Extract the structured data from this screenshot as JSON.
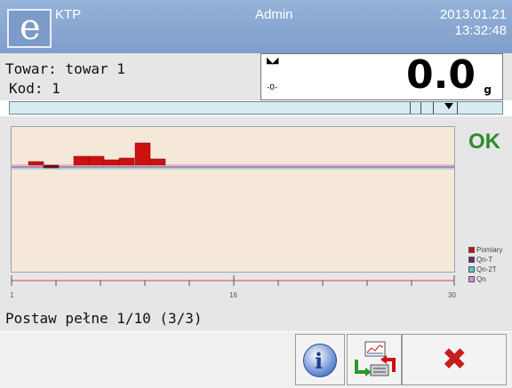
{
  "header": {
    "logo_letter": "e",
    "app_name": "KTP",
    "user": "Admin",
    "date": "2013.01.21",
    "time": "13:32:48"
  },
  "product": {
    "line1": "Towar: towar 1",
    "line2": "Kod: 1"
  },
  "display": {
    "zero_indicator": "-0-",
    "value": "0.0",
    "unit": "g"
  },
  "status": {
    "result": "OK",
    "message": "Postaw pełne 1/10 (3/3)"
  },
  "legend": [
    {
      "label": "Pomiary",
      "color": "#cc1111"
    },
    {
      "label": "Qn-T",
      "color": "#7a1f7a"
    },
    {
      "label": "Qn-2T",
      "color": "#5ac8c8"
    },
    {
      "label": "Qn",
      "color": "#d98ad9"
    }
  ],
  "chart_data": {
    "type": "bar",
    "x_ticks": [
      "1",
      "16",
      "30"
    ],
    "series": [
      {
        "name": "Pomiary",
        "color": "#cc1111"
      }
    ],
    "reference_lines": [
      {
        "name": "Qn-T",
        "color": "#7a1f7a"
      },
      {
        "name": "Qn-2T",
        "color": "#5ac8c8"
      },
      {
        "name": "Qn",
        "color": "#d98ad9"
      }
    ]
  },
  "buttons": {
    "info": "info-icon",
    "sequence": "sequence-icon",
    "cancel": "cancel-icon"
  }
}
